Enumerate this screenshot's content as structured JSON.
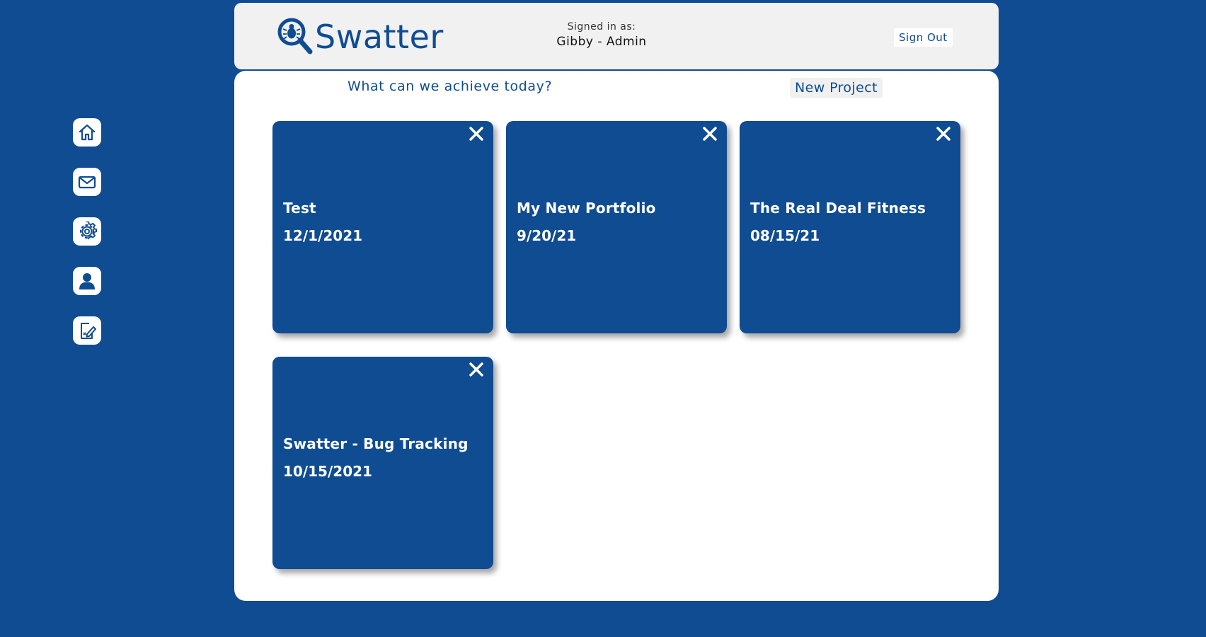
{
  "app": {
    "name": "Swatter"
  },
  "header": {
    "signed_in_label": "Signed in as:",
    "signed_in_user": "Gibby - Admin",
    "sign_out_label": "Sign Out"
  },
  "sidebar": {
    "items": [
      {
        "name": "home",
        "icon": "home-icon"
      },
      {
        "name": "messages",
        "icon": "mail-icon"
      },
      {
        "name": "settings",
        "icon": "gear-icon"
      },
      {
        "name": "profile",
        "icon": "user-icon"
      },
      {
        "name": "edit",
        "icon": "edit-document-icon"
      }
    ]
  },
  "main": {
    "tagline": "What can we achieve today?",
    "new_project_label": "New Project",
    "projects": [
      {
        "title": "Test",
        "date": "12/1/2021"
      },
      {
        "title": "My New Portfolio",
        "date": "9/20/21"
      },
      {
        "title": "The Real Deal Fitness",
        "date": "08/15/21"
      },
      {
        "title": "Swatter - Bug Tracking",
        "date": "10/15/2021"
      }
    ]
  },
  "colors": {
    "brand": "#0f4c92",
    "background": "#0f4c92",
    "header_bg": "#f1f1f1",
    "panel_bg": "#ffffff",
    "card_bg": "#0f4c92"
  }
}
